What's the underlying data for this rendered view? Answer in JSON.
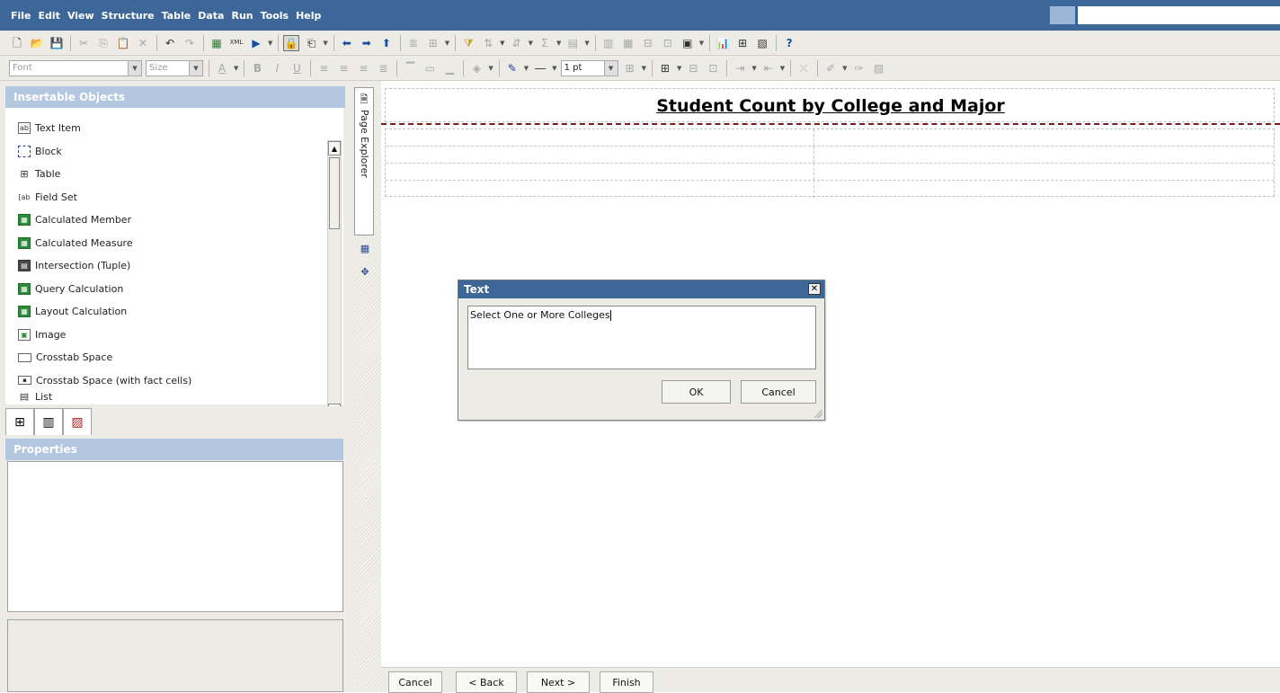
{
  "menubar": {
    "items": [
      "File",
      "Edit",
      "View",
      "Structure",
      "Table",
      "Data",
      "Run",
      "Tools",
      "Help"
    ]
  },
  "format_toolbar": {
    "font_placeholder": "Font",
    "size_placeholder": "Size",
    "line_weight": "1 pt"
  },
  "insertable_objects": {
    "title": "Insertable Objects",
    "items": [
      {
        "label": "Text Item",
        "icon": "text-item-icon"
      },
      {
        "label": "Block",
        "icon": "block-icon"
      },
      {
        "label": "Table",
        "icon": "table-icon"
      },
      {
        "label": "Field Set",
        "icon": "field-set-icon"
      },
      {
        "label": "Calculated Member",
        "icon": "calculated-member-icon"
      },
      {
        "label": "Calculated Measure",
        "icon": "calculated-measure-icon"
      },
      {
        "label": "Intersection (Tuple)",
        "icon": "intersection-icon"
      },
      {
        "label": "Query Calculation",
        "icon": "query-calculation-icon"
      },
      {
        "label": "Layout Calculation",
        "icon": "layout-calculation-icon"
      },
      {
        "label": "Image",
        "icon": "image-icon"
      },
      {
        "label": "Crosstab Space",
        "icon": "crosstab-space-icon"
      },
      {
        "label": "Crosstab Space (with fact cells)",
        "icon": "crosstab-space-fact-icon"
      },
      {
        "label": "List",
        "icon": "list-icon"
      }
    ]
  },
  "properties": {
    "title": "Properties"
  },
  "side_tabs": {
    "page_explorer": "Page Explorer"
  },
  "canvas": {
    "report_title": "Student Count by College and Major"
  },
  "dialog": {
    "title": "Text",
    "close_glyph": "✕",
    "text_value": "Select One or More Colleges",
    "ok_label": "OK",
    "cancel_label": "Cancel"
  },
  "wizard": {
    "cancel_label": "Cancel",
    "back_label": "< Back",
    "next_label": "Next >",
    "finish_label": "Finish"
  },
  "colors": {
    "menubar": "#3d6699",
    "panel_header": "#b4c7e0",
    "title_rule": "#7a1a1a"
  }
}
